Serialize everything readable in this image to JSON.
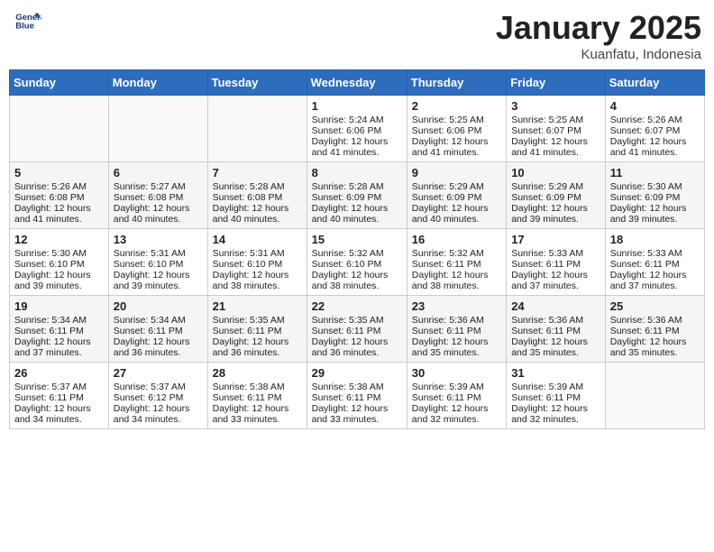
{
  "header": {
    "logo_line1": "General",
    "logo_line2": "Blue",
    "month": "January 2025",
    "location": "Kuanfatu, Indonesia"
  },
  "weekdays": [
    "Sunday",
    "Monday",
    "Tuesday",
    "Wednesday",
    "Thursday",
    "Friday",
    "Saturday"
  ],
  "rows": [
    [
      {
        "day": "",
        "info": ""
      },
      {
        "day": "",
        "info": ""
      },
      {
        "day": "",
        "info": ""
      },
      {
        "day": "1",
        "info": "Sunrise: 5:24 AM\nSunset: 6:06 PM\nDaylight: 12 hours\nand 41 minutes."
      },
      {
        "day": "2",
        "info": "Sunrise: 5:25 AM\nSunset: 6:06 PM\nDaylight: 12 hours\nand 41 minutes."
      },
      {
        "day": "3",
        "info": "Sunrise: 5:25 AM\nSunset: 6:07 PM\nDaylight: 12 hours\nand 41 minutes."
      },
      {
        "day": "4",
        "info": "Sunrise: 5:26 AM\nSunset: 6:07 PM\nDaylight: 12 hours\nand 41 minutes."
      }
    ],
    [
      {
        "day": "5",
        "info": "Sunrise: 5:26 AM\nSunset: 6:08 PM\nDaylight: 12 hours\nand 41 minutes."
      },
      {
        "day": "6",
        "info": "Sunrise: 5:27 AM\nSunset: 6:08 PM\nDaylight: 12 hours\nand 40 minutes."
      },
      {
        "day": "7",
        "info": "Sunrise: 5:28 AM\nSunset: 6:08 PM\nDaylight: 12 hours\nand 40 minutes."
      },
      {
        "day": "8",
        "info": "Sunrise: 5:28 AM\nSunset: 6:09 PM\nDaylight: 12 hours\nand 40 minutes."
      },
      {
        "day": "9",
        "info": "Sunrise: 5:29 AM\nSunset: 6:09 PM\nDaylight: 12 hours\nand 40 minutes."
      },
      {
        "day": "10",
        "info": "Sunrise: 5:29 AM\nSunset: 6:09 PM\nDaylight: 12 hours\nand 39 minutes."
      },
      {
        "day": "11",
        "info": "Sunrise: 5:30 AM\nSunset: 6:09 PM\nDaylight: 12 hours\nand 39 minutes."
      }
    ],
    [
      {
        "day": "12",
        "info": "Sunrise: 5:30 AM\nSunset: 6:10 PM\nDaylight: 12 hours\nand 39 minutes."
      },
      {
        "day": "13",
        "info": "Sunrise: 5:31 AM\nSunset: 6:10 PM\nDaylight: 12 hours\nand 39 minutes."
      },
      {
        "day": "14",
        "info": "Sunrise: 5:31 AM\nSunset: 6:10 PM\nDaylight: 12 hours\nand 38 minutes."
      },
      {
        "day": "15",
        "info": "Sunrise: 5:32 AM\nSunset: 6:10 PM\nDaylight: 12 hours\nand 38 minutes."
      },
      {
        "day": "16",
        "info": "Sunrise: 5:32 AM\nSunset: 6:11 PM\nDaylight: 12 hours\nand 38 minutes."
      },
      {
        "day": "17",
        "info": "Sunrise: 5:33 AM\nSunset: 6:11 PM\nDaylight: 12 hours\nand 37 minutes."
      },
      {
        "day": "18",
        "info": "Sunrise: 5:33 AM\nSunset: 6:11 PM\nDaylight: 12 hours\nand 37 minutes."
      }
    ],
    [
      {
        "day": "19",
        "info": "Sunrise: 5:34 AM\nSunset: 6:11 PM\nDaylight: 12 hours\nand 37 minutes."
      },
      {
        "day": "20",
        "info": "Sunrise: 5:34 AM\nSunset: 6:11 PM\nDaylight: 12 hours\nand 36 minutes."
      },
      {
        "day": "21",
        "info": "Sunrise: 5:35 AM\nSunset: 6:11 PM\nDaylight: 12 hours\nand 36 minutes."
      },
      {
        "day": "22",
        "info": "Sunrise: 5:35 AM\nSunset: 6:11 PM\nDaylight: 12 hours\nand 36 minutes."
      },
      {
        "day": "23",
        "info": "Sunrise: 5:36 AM\nSunset: 6:11 PM\nDaylight: 12 hours\nand 35 minutes."
      },
      {
        "day": "24",
        "info": "Sunrise: 5:36 AM\nSunset: 6:11 PM\nDaylight: 12 hours\nand 35 minutes."
      },
      {
        "day": "25",
        "info": "Sunrise: 5:36 AM\nSunset: 6:11 PM\nDaylight: 12 hours\nand 35 minutes."
      }
    ],
    [
      {
        "day": "26",
        "info": "Sunrise: 5:37 AM\nSunset: 6:11 PM\nDaylight: 12 hours\nand 34 minutes."
      },
      {
        "day": "27",
        "info": "Sunrise: 5:37 AM\nSunset: 6:12 PM\nDaylight: 12 hours\nand 34 minutes."
      },
      {
        "day": "28",
        "info": "Sunrise: 5:38 AM\nSunset: 6:11 PM\nDaylight: 12 hours\nand 33 minutes."
      },
      {
        "day": "29",
        "info": "Sunrise: 5:38 AM\nSunset: 6:11 PM\nDaylight: 12 hours\nand 33 minutes."
      },
      {
        "day": "30",
        "info": "Sunrise: 5:39 AM\nSunset: 6:11 PM\nDaylight: 12 hours\nand 32 minutes."
      },
      {
        "day": "31",
        "info": "Sunrise: 5:39 AM\nSunset: 6:11 PM\nDaylight: 12 hours\nand 32 minutes."
      },
      {
        "day": "",
        "info": ""
      }
    ]
  ]
}
